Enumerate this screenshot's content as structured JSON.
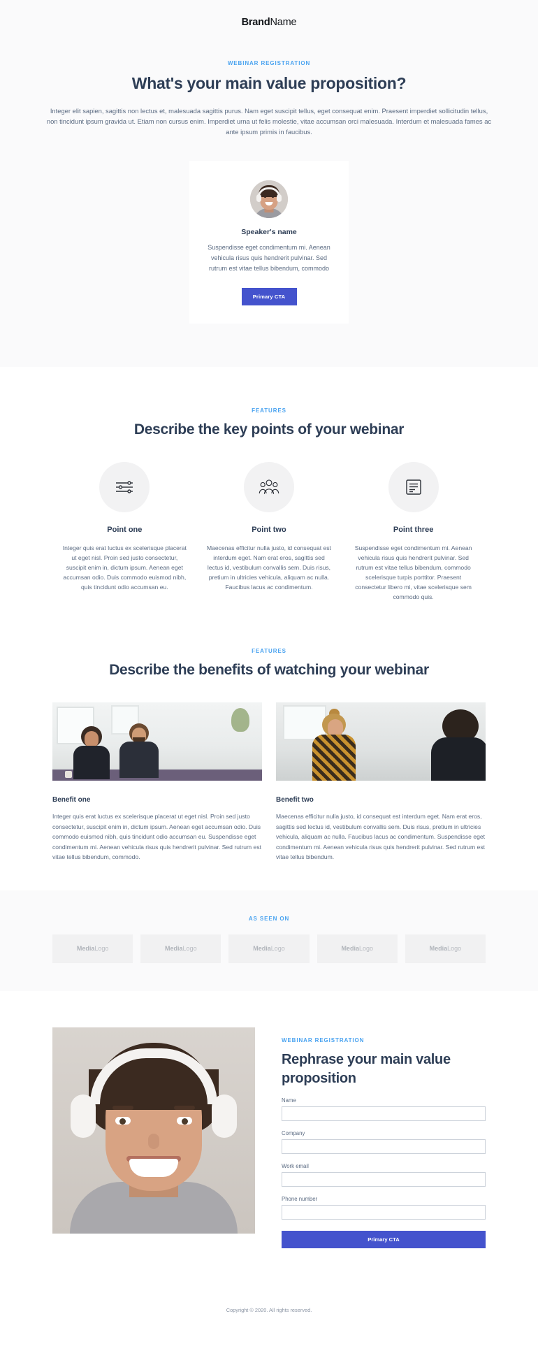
{
  "brand": {
    "bold": "Brand",
    "light": "Name"
  },
  "colors": {
    "accent_blue": "#4aa3f0",
    "cta_indigo": "#4453cd",
    "heading": "#2e3e56",
    "body_text": "#5b6b82",
    "section_bg": "#fafafb",
    "icon_circle": "#f2f2f3"
  },
  "hero": {
    "eyebrow": "WEBINAR REGISTRATION",
    "title": "What's your main value proposition?",
    "paragraph": "Integer elit sapien, sagittis non lectus et, malesuada sagittis purus. Nam eget suscipit tellus, eget consequat enim. Praesent imperdiet sollicitudin tellus, non tincidunt ipsum gravida ut. Etiam non cursus enim. Imperdiet urna ut felis molestie, vitae accumsan orci malesuada. Interdum et malesuada fames ac ante ipsum primis in faucibus.",
    "card": {
      "avatar_icon": "speaker-avatar-photo",
      "name": "Speaker's name",
      "bio": "Suspendisse eget condimentum mi. Aenean vehicula risus quis hendrerit pulvinar. Sed rutrum est vitae tellus bibendum, commodo",
      "cta_label": "Primary CTA"
    }
  },
  "features": {
    "eyebrow": "FEATURES",
    "title": "Describe the key points of your webinar",
    "points": [
      {
        "icon": "sliders-icon",
        "title": "Point one",
        "text": "Integer quis erat luctus ex scelerisque placerat ut eget nisl. Proin sed justo consectetur, suscipit enim in, dictum ipsum. Aenean eget accumsan odio. Duis commodo euismod nibh, quis tincidunt odio accumsan eu."
      },
      {
        "icon": "people-group-icon",
        "title": "Point two",
        "text": "Maecenas efficitur nulla justo, id consequat est interdum eget. Nam erat eros, sagittis sed lectus id, vestibulum convallis sem. Duis risus, pretium in ultricies vehicula, aliquam ac nulla. Faucibus lacus ac condimentum."
      },
      {
        "icon": "document-text-icon",
        "title": "Point three",
        "text": "Suspendisse eget condimentum mi. Aenean vehicula risus quis hendrerit pulvinar. Sed rutrum est vitae tellus bibendum, commodo scelerisque turpis porttitor. Praesent consectetur libero mi, vitae scelerisque sem commodo quis."
      }
    ]
  },
  "benefits": {
    "eyebrow": "FEATURES",
    "title": "Describe the benefits of watching your webinar",
    "items": [
      {
        "photo_icon": "office-meeting-photo",
        "title": "Benefit one",
        "text": "Integer quis erat luctus ex scelerisque placerat ut eget nisl. Proin sed justo consectetur, suscipit enim in, dictum ipsum. Aenean eget accumsan odio. Duis commodo euismod nibh, quis tincidunt odio accumsan eu. Suspendisse eget condimentum mi. Aenean vehicula risus quis hendrerit pulvinar. Sed rutrum est vitae tellus bibendum, commodo."
      },
      {
        "photo_icon": "conversation-photo",
        "title": "Benefit two",
        "text": "Maecenas efficitur nulla justo, id consequat est interdum eget. Nam erat eros, sagittis sed lectus id, vestibulum convallis sem. Duis risus, pretium in ultricies vehicula, aliquam ac nulla. Faucibus lacus ac condimentum. Suspendisse eget condimentum mi. Aenean vehicula risus quis hendrerit pulvinar. Sed rutrum est vitae tellus bibendum."
      }
    ]
  },
  "seen_on": {
    "eyebrow": "AS SEEN ON",
    "logos": [
      {
        "bold": "Media",
        "light": "Logo"
      },
      {
        "bold": "Media",
        "light": "Logo"
      },
      {
        "bold": "Media",
        "light": "Logo"
      },
      {
        "bold": "Media",
        "light": "Logo"
      },
      {
        "bold": "Media",
        "light": "Logo"
      }
    ]
  },
  "signup": {
    "photo_icon": "woman-with-headphones-photo",
    "eyebrow": "WEBINAR REGISTRATION",
    "title": "Rephrase your main value proposition",
    "fields": [
      {
        "label": "Name",
        "value": "",
        "placeholder": ""
      },
      {
        "label": "Company",
        "value": "",
        "placeholder": ""
      },
      {
        "label": "Work email",
        "value": "",
        "placeholder": ""
      },
      {
        "label": "Phone number",
        "value": "",
        "placeholder": ""
      }
    ],
    "cta_label": "Primary CTA"
  },
  "footer": {
    "copyright": "Copyright © 2020. All rights reserved."
  }
}
